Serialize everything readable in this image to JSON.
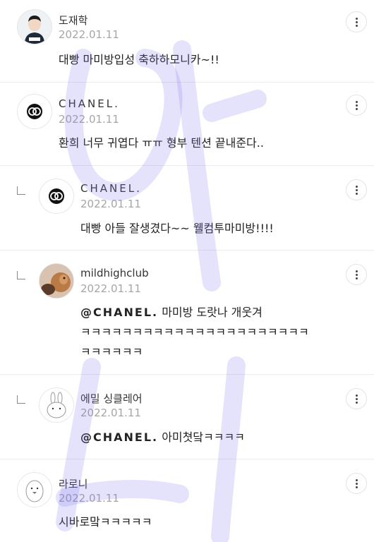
{
  "comments": [
    {
      "name": "도재학",
      "date": "2022.01.11",
      "text": "대빵 마미방입성 축하하모니카~!!"
    },
    {
      "name": "CHANEL.",
      "date": "2022.01.11",
      "text": "환희 너무 귀엽다 ㅠㅠ 형부 텐션 끝내준다.."
    },
    {
      "name": "CHANEL.",
      "date": "2022.01.11",
      "text": "대빵 아들 잘생겼다~~ 웰컴투마미방!!!!"
    },
    {
      "name": "mildhighclub",
      "date": "2022.01.11",
      "mention": "@CHANEL.",
      "text": " 마미방 도랏나 개웃겨",
      "text2": "ㅋㅋㅋㅋㅋㅋㅋㅋㅋㅋㅋㅋㅋㅋㅋㅋㅋㅋㅋㅋㅋㅋ",
      "text3": "ㅋㅋㅋㅋㅋㅋ"
    },
    {
      "name": "에밀 싱클레어",
      "date": "2022.01.11",
      "mention": "@CHANEL.",
      "text": " 아미쳣닼ㅋㅋㅋㅋ"
    },
    {
      "name": "라로니",
      "date": "2022.01.11",
      "text": "시바로맠ㅋㅋㅋㅋㅋ"
    }
  ],
  "colors": {
    "watermark": "#7b72f2",
    "meta": "#a6a6a6"
  },
  "icons": {
    "more": "more-vertical-icon",
    "reply": "reply-arrow-icon"
  }
}
